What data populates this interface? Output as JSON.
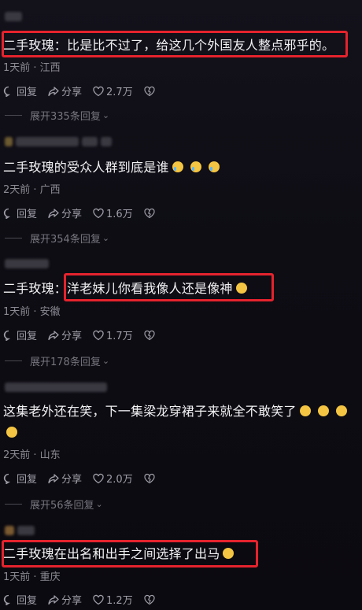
{
  "comments": [
    {
      "user": "",
      "text": "二手玫瑰：比是比不过了，给这几个外国友人整点邪乎的。",
      "meta": "1天前 · 江西",
      "reply": "回复",
      "share": "分享",
      "likes": "2.7万",
      "expand": "展开335条回复"
    },
    {
      "user": "",
      "text": "二手玫瑰的受众人群到底是谁",
      "emojis": [
        "cry-laugh-icon",
        "cry-laugh-icon",
        "cry-laugh-icon"
      ],
      "meta": "2天前 · 广西",
      "reply": "回复",
      "share": "分享",
      "likes": "1.6万",
      "expand": "展开354条回复"
    },
    {
      "user": "",
      "text_prefix": "二手玫瑰：",
      "text": "洋老妹儿你看我像人还是像神",
      "meta": "1天前 · 安徽",
      "reply": "回复",
      "share": "分享",
      "likes": "1.7万",
      "expand": "展开178条回复"
    },
    {
      "user": "",
      "text": "这集老外还在笑，下一集梁龙穿裙子来就全不敢笑了",
      "meta": "2天前 · 山东",
      "reply": "回复",
      "share": "分享",
      "likes": "2.0万",
      "expand": "展开56条回复"
    },
    {
      "user": "",
      "text": "二手玫瑰在出名和出手之间选择了出马",
      "meta": "1天前 · 重庆",
      "reply": "回复",
      "share": "分享",
      "likes": "1.2万"
    }
  ],
  "colors": {
    "highlight": "#e5232d",
    "background": "#0e0d14"
  }
}
